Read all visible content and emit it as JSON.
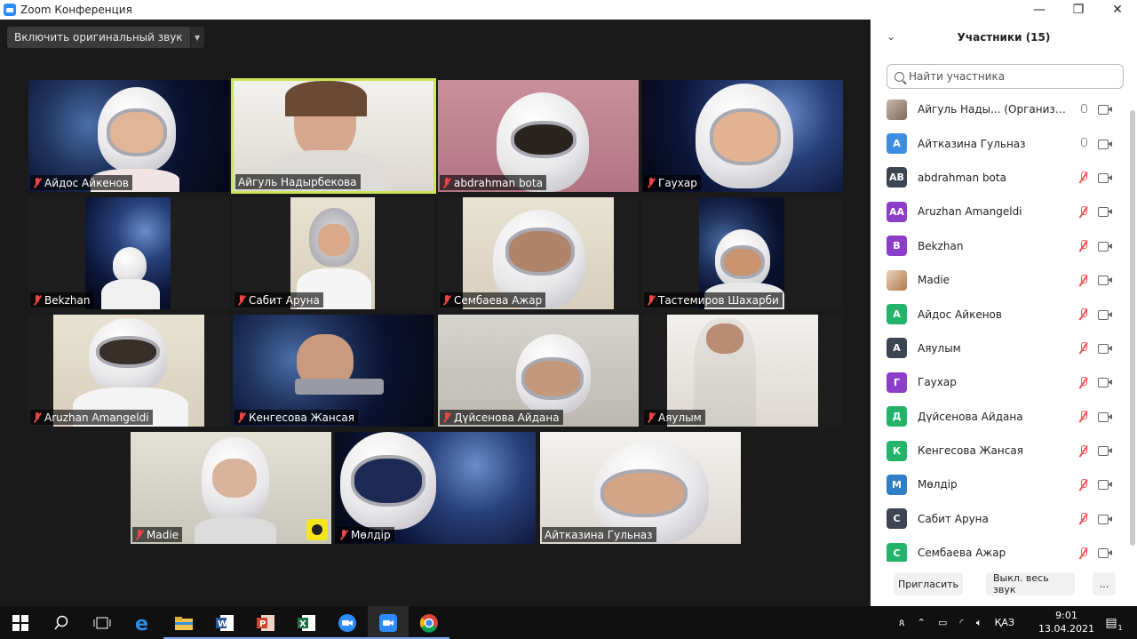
{
  "window": {
    "title": "Zoom Конференция",
    "minimize": "—",
    "maximize": "❐",
    "close": "✕"
  },
  "toolbar": {
    "original_sound_label": "Включить оригинальный звук",
    "dropdown": "▼"
  },
  "tiles": [
    {
      "name": "Айдос Айкенов",
      "muted": true
    },
    {
      "name": "Айгуль Надырбекова",
      "muted": false,
      "active": true
    },
    {
      "name": "abdrahman bota",
      "muted": true
    },
    {
      "name": "Гаухар",
      "muted": true
    },
    {
      "name": "Bekzhan",
      "muted": true
    },
    {
      "name": "Сабит Аруна",
      "muted": true
    },
    {
      "name": "Сембаева Ажар",
      "muted": true
    },
    {
      "name": "Тастемиров Шахарби",
      "muted": true
    },
    {
      "name": "Aruzhan Amangeldi",
      "muted": true
    },
    {
      "name": "Кенгесова Жансая",
      "muted": true
    },
    {
      "name": "Дүйсенова Айдана",
      "muted": true
    },
    {
      "name": "Аяулым",
      "muted": true
    },
    {
      "name": "Madie",
      "muted": true
    },
    {
      "name": "Мөлдір",
      "muted": true
    },
    {
      "name": "Айтказина Гульназ",
      "muted": false
    }
  ],
  "panel": {
    "title": "Участники (15)",
    "collapse_icon": "⌄",
    "search_placeholder": "Найти участника",
    "participants": [
      {
        "initials": "",
        "name": "Айгуль Нады...  (Организатор, я)",
        "color": "",
        "mic": "on"
      },
      {
        "initials": "А",
        "name": "Айтказина Гульназ",
        "color": "#3b8ee0",
        "mic": "on"
      },
      {
        "initials": "AB",
        "name": "abdrahman bota",
        "color": "#3d4452",
        "mic": "off"
      },
      {
        "initials": "AA",
        "name": "Aruzhan Amangeldi",
        "color": "#8b3fc9",
        "mic": "off"
      },
      {
        "initials": "B",
        "name": "Bekzhan",
        "color": "#8b3fc9",
        "mic": "off"
      },
      {
        "initials": "",
        "name": "Madie",
        "color": "",
        "mic": "off"
      },
      {
        "initials": "А",
        "name": "Айдос Айкенов",
        "color": "#24b36b",
        "mic": "off"
      },
      {
        "initials": "А",
        "name": "Аяулым",
        "color": "#3d4452",
        "mic": "off"
      },
      {
        "initials": "Г",
        "name": "Гаухар",
        "color": "#8b3fc9",
        "mic": "off"
      },
      {
        "initials": "Д",
        "name": "Дүйсенова Айдана",
        "color": "#24b36b",
        "mic": "off"
      },
      {
        "initials": "К",
        "name": "Кенгесова Жансая",
        "color": "#24b36b",
        "mic": "off"
      },
      {
        "initials": "М",
        "name": "Мөлдір",
        "color": "#2f7fc6",
        "mic": "off"
      },
      {
        "initials": "С",
        "name": "Сабит Аруна",
        "color": "#3d4452",
        "mic": "off"
      },
      {
        "initials": "С",
        "name": "Сембаева Ажар",
        "color": "#24b36b",
        "mic": "off"
      }
    ],
    "invite_label": "Пригласить",
    "mute_all_label": "Выкл. весь звук",
    "more_label": "..."
  },
  "taskbar": {
    "lang": "ҚАЗ",
    "time": "9:01",
    "date": "13.04.2021",
    "notif_count": "1",
    "apps": [
      "start-icon",
      "search-icon",
      "task-view-icon",
      "edge-icon",
      "explorer-icon",
      "word-icon",
      "powerpoint-icon",
      "excel-icon",
      "zoom-meetings-icon",
      "zoom-icon",
      "chrome-icon"
    ]
  }
}
